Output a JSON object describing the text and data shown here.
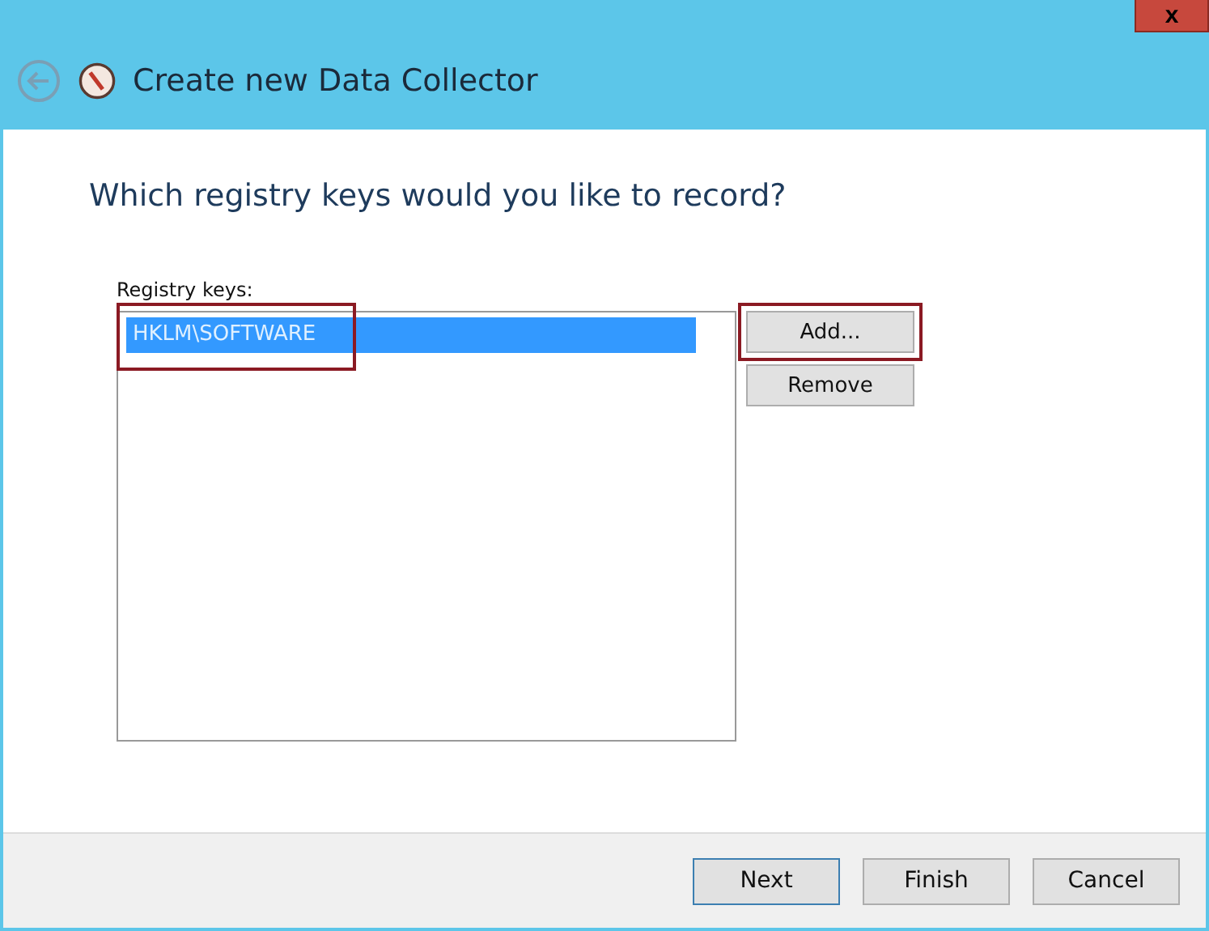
{
  "window": {
    "title": "Create new Data Collector",
    "close": "x"
  },
  "heading": "Which registry keys would you like to record?",
  "registry_keys": {
    "label": "Registry keys:",
    "items": [
      {
        "text": "HKLM\\SOFTWARE",
        "selected": true,
        "highlighted": true
      }
    ]
  },
  "side_buttons": [
    {
      "label": "Add...",
      "highlighted": true
    },
    {
      "label": "Remove",
      "highlighted": false
    }
  ],
  "footer_buttons": [
    {
      "label": "Next",
      "default": true
    },
    {
      "label": "Finish",
      "default": false
    },
    {
      "label": "Cancel",
      "default": false
    }
  ]
}
